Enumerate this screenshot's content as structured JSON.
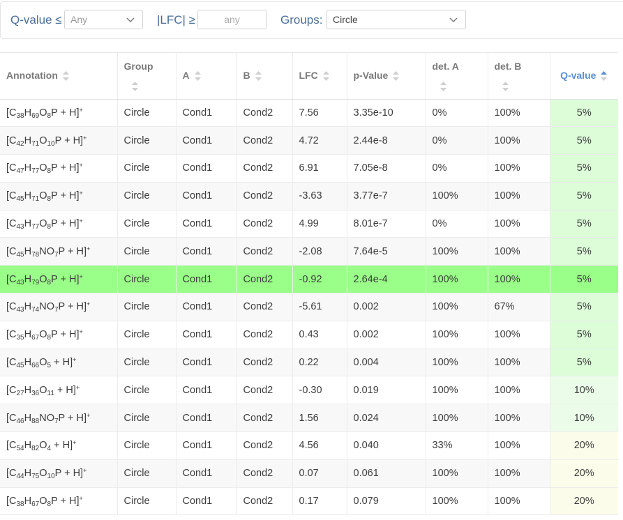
{
  "filters": {
    "qvalue_label": "Q-value ≤",
    "qvalue_selected": "Any",
    "lfc_label": "|LFC| ≥",
    "lfc_placeholder": "any",
    "groups_label": "Groups:",
    "groups_selected": "Circle"
  },
  "table": {
    "columns": [
      "Annotation",
      "Group",
      "A",
      "B",
      "LFC",
      "p-Value",
      "det. A",
      "det. B",
      "Q-value"
    ],
    "sorted_column": "Q-value",
    "sort_direction": "ascending",
    "selected_row_index": 6,
    "colors": {
      "selected_row": "#99ff88",
      "q5": "#dcfdd8",
      "q10": "#ebfde9",
      "q20": "#fbfdea",
      "sorted_header": "#5b8fd8"
    },
    "rows": [
      {
        "annotation": "[C38H69O8P + H]+",
        "group": "Circle",
        "a": "Cond1",
        "b": "Cond2",
        "lfc": "7.56",
        "p": "3.35e-10",
        "det_a": "0%",
        "det_b": "100%",
        "q": "5%"
      },
      {
        "annotation": "[C42H71O10P + H]+",
        "group": "Circle",
        "a": "Cond1",
        "b": "Cond2",
        "lfc": "4.72",
        "p": "2.44e-8",
        "det_a": "0%",
        "det_b": "100%",
        "q": "5%"
      },
      {
        "annotation": "[C47H77O8P + H]+",
        "group": "Circle",
        "a": "Cond1",
        "b": "Cond2",
        "lfc": "6.91",
        "p": "7.05e-8",
        "det_a": "0%",
        "det_b": "100%",
        "q": "5%"
      },
      {
        "annotation": "[C45H71O8P + H]+",
        "group": "Circle",
        "a": "Cond1",
        "b": "Cond2",
        "lfc": "-3.63",
        "p": "3.77e-7",
        "det_a": "100%",
        "det_b": "100%",
        "q": "5%"
      },
      {
        "annotation": "[C43H77O8P + H]+",
        "group": "Circle",
        "a": "Cond1",
        "b": "Cond2",
        "lfc": "4.99",
        "p": "8.01e-7",
        "det_a": "0%",
        "det_b": "100%",
        "q": "5%"
      },
      {
        "annotation": "[C45H78NO7P + H]+",
        "group": "Circle",
        "a": "Cond1",
        "b": "Cond2",
        "lfc": "-2.08",
        "p": "7.64e-5",
        "det_a": "100%",
        "det_b": "100%",
        "q": "5%"
      },
      {
        "annotation": "[C43H79O8P + H]+",
        "group": "Circle",
        "a": "Cond1",
        "b": "Cond2",
        "lfc": "-0.92",
        "p": "2.64e-4",
        "det_a": "100%",
        "det_b": "100%",
        "q": "5%"
      },
      {
        "annotation": "[C43H74NO7P + H]+",
        "group": "Circle",
        "a": "Cond1",
        "b": "Cond2",
        "lfc": "-5.61",
        "p": "0.002",
        "det_a": "100%",
        "det_b": "67%",
        "q": "5%"
      },
      {
        "annotation": "[C35H67O8P + H]+",
        "group": "Circle",
        "a": "Cond1",
        "b": "Cond2",
        "lfc": "0.43",
        "p": "0.002",
        "det_a": "100%",
        "det_b": "100%",
        "q": "5%"
      },
      {
        "annotation": "[C45H66O5 + H]+",
        "group": "Circle",
        "a": "Cond1",
        "b": "Cond2",
        "lfc": "0.22",
        "p": "0.004",
        "det_a": "100%",
        "det_b": "100%",
        "q": "5%"
      },
      {
        "annotation": "[C27H36O11 + H]+",
        "group": "Circle",
        "a": "Cond1",
        "b": "Cond2",
        "lfc": "-0.30",
        "p": "0.019",
        "det_a": "100%",
        "det_b": "100%",
        "q": "10%"
      },
      {
        "annotation": "[C46H88NO7P + H]+",
        "group": "Circle",
        "a": "Cond1",
        "b": "Cond2",
        "lfc": "1.56",
        "p": "0.024",
        "det_a": "100%",
        "det_b": "100%",
        "q": "10%"
      },
      {
        "annotation": "[C54H82O4 + H]+",
        "group": "Circle",
        "a": "Cond1",
        "b": "Cond2",
        "lfc": "4.56",
        "p": "0.040",
        "det_a": "33%",
        "det_b": "100%",
        "q": "20%"
      },
      {
        "annotation": "[C44H75O10P + H]+",
        "group": "Circle",
        "a": "Cond1",
        "b": "Cond2",
        "lfc": "0.07",
        "p": "0.061",
        "det_a": "100%",
        "det_b": "100%",
        "q": "20%"
      },
      {
        "annotation": "[C38H67O8P + H]+",
        "group": "Circle",
        "a": "Cond1",
        "b": "Cond2",
        "lfc": "0.17",
        "p": "0.079",
        "det_a": "100%",
        "det_b": "100%",
        "q": "20%"
      }
    ]
  }
}
